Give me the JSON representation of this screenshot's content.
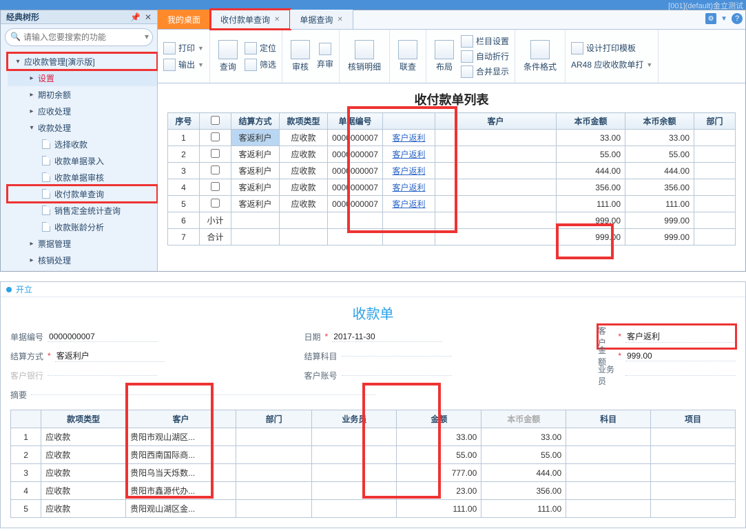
{
  "top_strip": "[001](default)金立测试",
  "sidebar": {
    "title": "经典树形",
    "search_placeholder": "请输入您要搜索的功能",
    "root": "应收款管理[演示版]",
    "items": [
      {
        "label": "设置",
        "lv": 2,
        "chev": "▸",
        "active": true
      },
      {
        "label": "期初余额",
        "lv": 2,
        "chev": "▸"
      },
      {
        "label": "应收处理",
        "lv": 2,
        "chev": "▸"
      },
      {
        "label": "收款处理",
        "lv": 2,
        "chev": "▾"
      },
      {
        "label": "选择收款",
        "lv": 3,
        "doc": true
      },
      {
        "label": "收款单据录入",
        "lv": 3,
        "doc": true
      },
      {
        "label": "收款单据审核",
        "lv": 3,
        "doc": true
      },
      {
        "label": "收付款单查询",
        "lv": 3,
        "doc": true,
        "hl": true
      },
      {
        "label": "销售定金统计查询",
        "lv": 3,
        "doc": true
      },
      {
        "label": "收款账龄分析",
        "lv": 3,
        "doc": true
      },
      {
        "label": "票据管理",
        "lv": 2,
        "chev": "▸"
      },
      {
        "label": "核销处理",
        "lv": 2,
        "chev": "▸"
      }
    ]
  },
  "tabs": [
    {
      "label": "我的桌面",
      "primary": true
    },
    {
      "label": "收付款单查询",
      "close": true,
      "hl": true
    },
    {
      "label": "单据查询",
      "close": true
    }
  ],
  "ribbon": {
    "print": "打印",
    "export": "输出",
    "query": "查询",
    "locate": "定位",
    "filter": "筛选",
    "audit": "审核",
    "abandon": "弃审",
    "detail": "核销明细",
    "link": "联查",
    "layout": "布局",
    "colset": "栏目设置",
    "autowrap": "自动折行",
    "merge": "合并显示",
    "cond": "条件格式",
    "designtmpl": "设计打印模板",
    "ar48": "AR48 应收收款单打"
  },
  "list": {
    "title": "收付款单列表",
    "headers": [
      "序号",
      "",
      "结算方式",
      "款项类型",
      "单据编号",
      "",
      "客户",
      "本币金额",
      "本币余额",
      "部门"
    ],
    "rows": [
      {
        "idx": "1",
        "settle": "客返利户",
        "type": "应收款",
        "doc": "0000000007",
        "link": "客户返利",
        "amt": "33.00",
        "bal": "33.00",
        "sel": true
      },
      {
        "idx": "2",
        "settle": "客返利户",
        "type": "应收款",
        "doc": "0000000007",
        "link": "客户返利",
        "amt": "55.00",
        "bal": "55.00"
      },
      {
        "idx": "3",
        "settle": "客返利户",
        "type": "应收款",
        "doc": "0000000007",
        "link": "客户返利",
        "amt": "444.00",
        "bal": "444.00"
      },
      {
        "idx": "4",
        "settle": "客返利户",
        "type": "应收款",
        "doc": "0000000007",
        "link": "客户返利",
        "amt": "356.00",
        "bal": "356.00"
      },
      {
        "idx": "5",
        "settle": "客返利户",
        "type": "应收款",
        "doc": "0000000007",
        "link": "客户返利",
        "amt": "111.00",
        "bal": "111.00"
      }
    ],
    "subtotal": {
      "idx": "6",
      "label": "小计",
      "amt": "999.00",
      "bal": "999.00"
    },
    "total": {
      "idx": "7",
      "label": "合计",
      "amt": "999.00",
      "bal": "999.00"
    }
  },
  "lower": {
    "status": "开立",
    "title": "收款单",
    "fields": {
      "docno_label": "单据编号",
      "docno": "0000000007",
      "date_label": "日期",
      "date": "2017-11-30",
      "cust_label": "客户",
      "cust": "客户返利",
      "settle_label": "结算方式",
      "settle": "客返利户",
      "subj_label": "结算科目",
      "subj": "",
      "amt_label": "金额",
      "amt": "999.00",
      "bank_label": "客户银行",
      "bank": "",
      "acct_label": "客户账号",
      "acct": "",
      "sales_label": "业务员",
      "sales": "",
      "memo_label": "摘要",
      "memo": ""
    },
    "detail_headers": [
      "",
      "款项类型",
      "客户",
      "部门",
      "业务员",
      "金额",
      "本币金额",
      "科目",
      "项目"
    ],
    "detail": [
      {
        "idx": "1",
        "type": "应收款",
        "cust": "贵阳市观山湖区...",
        "amt": "33.00",
        "base": "33.00"
      },
      {
        "idx": "2",
        "type": "应收款",
        "cust": "贵阳西南国际商...",
        "amt": "55.00",
        "base": "55.00"
      },
      {
        "idx": "3",
        "type": "应收款",
        "cust": "贵阳乌当天烁数...",
        "amt": "777.00",
        "base": "444.00"
      },
      {
        "idx": "4",
        "type": "应收款",
        "cust": "贵阳市鑫源代办...",
        "amt": "23.00",
        "base": "356.00"
      },
      {
        "idx": "5",
        "type": "应收款",
        "cust": "贵阳观山湖区金...",
        "amt": "111.00",
        "base": "111.00"
      }
    ]
  }
}
